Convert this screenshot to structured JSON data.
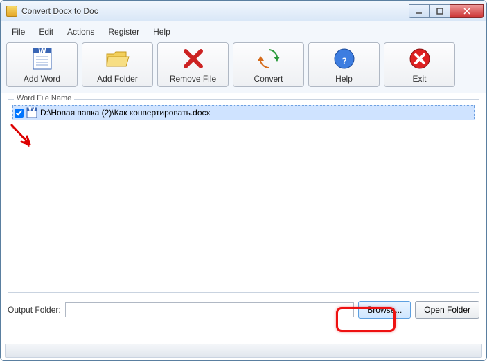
{
  "window": {
    "title": "Convert Docx to Doc"
  },
  "menu": {
    "file": "File",
    "edit": "Edit",
    "actions": "Actions",
    "register": "Register",
    "help": "Help"
  },
  "toolbar": {
    "add_word": "Add Word",
    "add_folder": "Add Folder",
    "remove_file": "Remove File",
    "convert": "Convert",
    "help": "Help",
    "exit": "Exit"
  },
  "filelist": {
    "legend": "Word File Name",
    "items": [
      {
        "checked": true,
        "path": "D:\\Новая папка (2)\\Как конвертировать.docx",
        "selected": true
      }
    ]
  },
  "output": {
    "label": "Output Folder:",
    "value": "",
    "browse": "Browse...",
    "open_folder": "Open Folder"
  }
}
